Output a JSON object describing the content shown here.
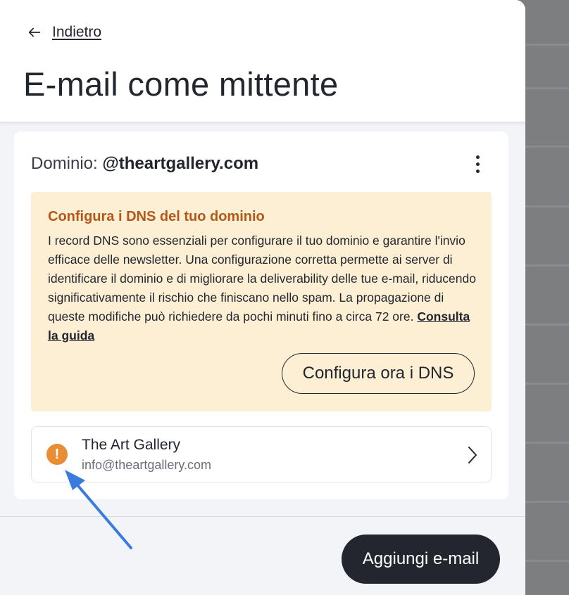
{
  "header": {
    "back_label": "Indietro",
    "title": "E-mail come mittente"
  },
  "domain": {
    "prefix": "Dominio:",
    "value": "@theartgallery.com"
  },
  "alert": {
    "title": "Configura i DNS del tuo dominio",
    "body": "I record DNS sono essenziali per configurare il tuo dominio e garantire l'invio efficace delle newsletter. Una configurazione corretta permette ai server di identificare il dominio e di migliorare la deliverability delle tue e-mail, riducendo significativamente il rischio che finiscano nello spam. La propagazione di queste modifiche può richiedere da pochi minuti fino a circa 72 ore.",
    "guide_link": "Consulta la guida",
    "button_label": "Configura ora i DNS"
  },
  "sender": {
    "name": "The Art Gallery",
    "email": "info@theartgallery.com",
    "status_icon": "exclamation-icon",
    "status_color": "#e98d35"
  },
  "footer": {
    "add_label": "Aggiungi e-mail"
  },
  "annotation": {
    "arrow_color": "#3a7be0"
  }
}
